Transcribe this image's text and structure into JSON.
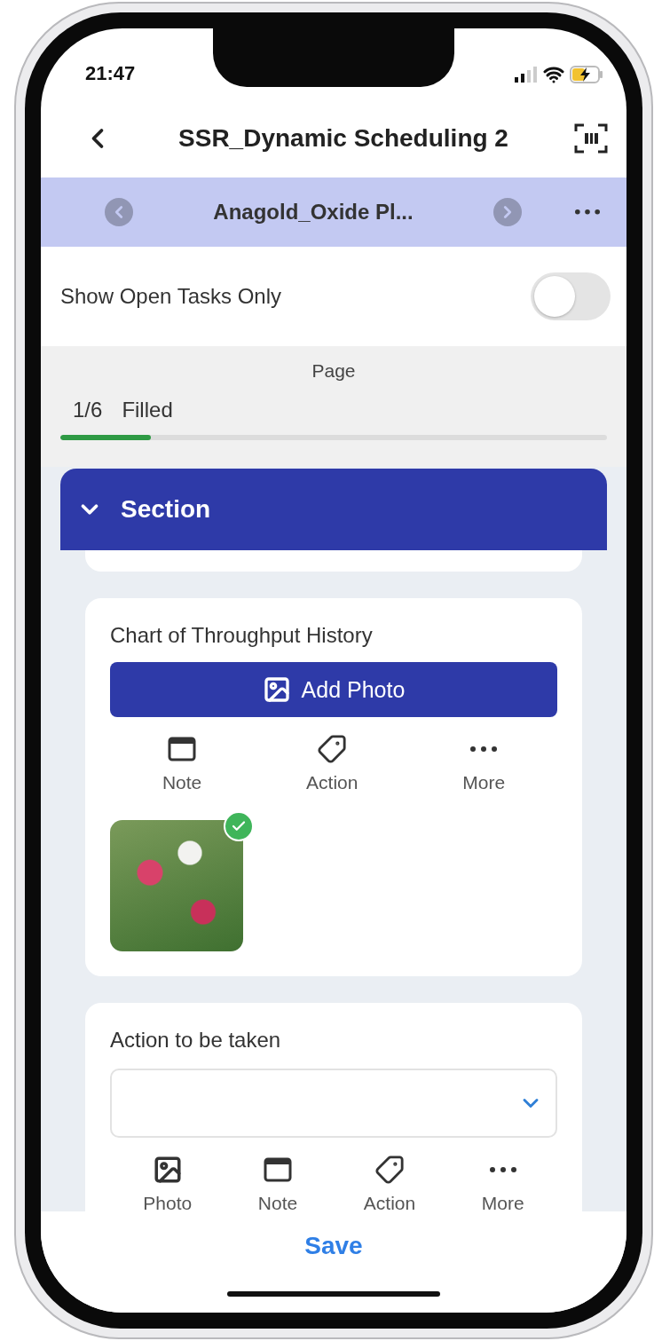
{
  "status_bar": {
    "time": "21:47"
  },
  "header": {
    "title": "SSR_Dynamic Scheduling 2"
  },
  "record_bar": {
    "title": "Anagold_Oxide Pl..."
  },
  "filter": {
    "label": "Show Open Tasks Only",
    "on": false
  },
  "progress": {
    "heading": "Page",
    "count": "1/6",
    "label": "Filled",
    "level": 0.165
  },
  "section": {
    "title": "Section",
    "expanded": true
  },
  "questions": [
    {
      "kind": "photo",
      "title": "Chart of Throughput History",
      "button": "Add Photo",
      "actions": [
        {
          "kind": "note",
          "label": "Note"
        },
        {
          "kind": "action",
          "label": "Action"
        },
        {
          "kind": "more",
          "label": "More"
        }
      ],
      "photos": [
        {
          "uploaded": true
        }
      ]
    },
    {
      "kind": "dropdown",
      "title": "Action to be taken",
      "actions": [
        {
          "kind": "photo",
          "label": "Photo"
        },
        {
          "kind": "note",
          "label": "Note"
        },
        {
          "kind": "action",
          "label": "Action"
        },
        {
          "kind": "more",
          "label": "More"
        }
      ]
    }
  ],
  "footer": {
    "save": "Save"
  }
}
